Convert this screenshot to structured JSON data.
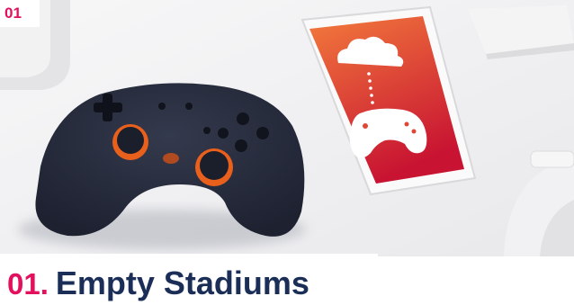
{
  "badge": {
    "label": "01"
  },
  "heading": {
    "number": "01.",
    "title": "Empty Stadiums"
  },
  "colors": {
    "accent": "#e3105e",
    "title": "#1a2e57",
    "controller": "#232838",
    "controller_accent": "#e8601c",
    "phone_screen_top": "#f0703a",
    "phone_screen_bottom": "#c91634"
  },
  "icons": [
    "cloud-icon",
    "game-controller-icon"
  ]
}
